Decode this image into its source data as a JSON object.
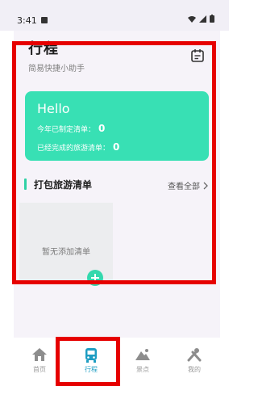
{
  "status_bar": {
    "time": "3:41"
  },
  "header": {
    "title": "行程",
    "subtitle": "简易快捷小助手",
    "calendar_icon": "calendar-icon"
  },
  "summary_card": {
    "greeting": "Hello",
    "planned_label": "今年已制定清单：",
    "planned_count": "0",
    "completed_label": "已经完成的旅游清单：",
    "completed_count": "0",
    "color": "#38e0b4"
  },
  "packing_section": {
    "title": "打包旅游清单",
    "view_all": "查看全部",
    "empty_text": "暂无添加清单",
    "add_icon": "plus-icon"
  },
  "tabbar": {
    "items": [
      {
        "label": "首页",
        "icon": "home-icon"
      },
      {
        "label": "行程",
        "icon": "bus-icon"
      },
      {
        "label": "景点",
        "icon": "mountain-icon"
      },
      {
        "label": "我的",
        "icon": "tools-icon"
      }
    ],
    "active_color": "#1e9dc2"
  }
}
